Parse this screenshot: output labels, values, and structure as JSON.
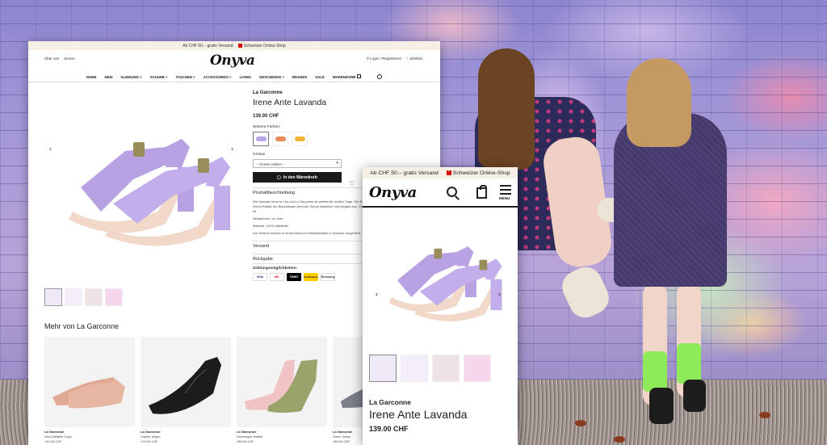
{
  "topbar": {
    "shipping": "Ab CHF 50.– gratis Versand",
    "online_shop": "Schweizer Online-Shop"
  },
  "brand": {
    "logo": "Onyva"
  },
  "desktop": {
    "header": {
      "left_links": [
        "Über uns",
        "Stores"
      ],
      "login": "Login / Registrieren",
      "wishlist": "Wishlist"
    },
    "nav": [
      "HOME",
      "NEW",
      "KLEIDUNG ˅",
      "SCHUHE ˅",
      "TASCHEN ˅",
      "ACCESSOIRES ˅",
      "LIVING",
      "GESCHENKE ˅",
      "BRANDS",
      "SALE",
      "WARENKORB"
    ],
    "product": {
      "brand": "La Garconne",
      "title": "Irene Ante Lavanda",
      "price": "139.00 CHF",
      "more_colors_label": "Weitere Farben:",
      "size_label": "Grösse",
      "size_placeholder": "-- Grösse wählen --",
      "add_to_cart": "In den Warenkorb",
      "description_heading": "Produktbeschreibung",
      "description": [
        "Die Sandale Irene in Lila von La Garçonne ist perfekt für schöne Tage. Die Sandale hat einen verstellbaren Riemen, welcher mit einem Elastic am Blockabsatz zieht der Schuh klassisch und elegant aus. Die weiche Sohle macht den Schuh bequem zu tragen ist.",
        "Absatzhöhe: ca. 6cm",
        "Material: 100% Wildleder",
        "Die Schuhe werden in einem kleinen Familienbetrieb in Spanien hergestellt."
      ],
      "shipping_heading": "Versand",
      "returns_heading": "Rückgabe",
      "payments_label": "Zahlungsmöglichkeiten:",
      "payments": [
        "VISA",
        "MC",
        "TWINT",
        "PostFinance",
        "Rechnung"
      ]
    },
    "more": {
      "title": "Mehr von La Garconne",
      "cards": [
        {
          "brand": "La Garconne",
          "name": "Vero Metallic Copa",
          "price": "149.00 CHF"
        },
        {
          "brand": "La Garconne",
          "name": "Sophie Negro",
          "price": "179.00 CHF"
        },
        {
          "brand": "La Garconne",
          "name": "Dominique Martial",
          "price": "159.00 CHF"
        },
        {
          "brand": "La Garconne",
          "name": "Gwen Jeans",
          "price": "169.00 CHF"
        }
      ]
    }
  },
  "mobile": {
    "menu_label": "MENU",
    "product": {
      "brand": "La Garconne",
      "title": "Irene Ante Lavanda",
      "price": "139.00 CHF"
    }
  },
  "colors": {
    "lavender": "#b9a4e6",
    "accent_red": "#d40000",
    "topbar_bg": "#f5efe6",
    "dark": "#1a1a1a"
  }
}
